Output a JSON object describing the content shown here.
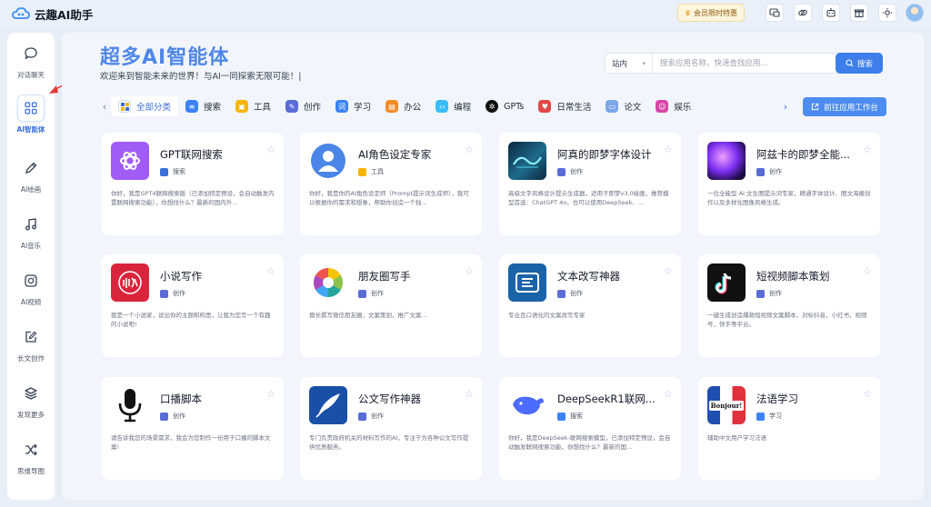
{
  "app": {
    "title": "云趣AI助手"
  },
  "topbar": {
    "vip_label": "会员限时特惠"
  },
  "sidebar": {
    "items": [
      {
        "label": "对话聊天",
        "icon": "chat-icon"
      },
      {
        "label": "AI智能体",
        "icon": "grid-icon",
        "active": true
      },
      {
        "label": "AI绘画",
        "icon": "pen-icon"
      },
      {
        "label": "AI音乐",
        "icon": "music-icon"
      },
      {
        "label": "AI视频",
        "icon": "video-icon"
      },
      {
        "label": "长文创作",
        "icon": "edit-icon"
      },
      {
        "label": "发现更多",
        "icon": "layers-icon"
      },
      {
        "label": "思维导图",
        "icon": "shuffle-icon"
      }
    ]
  },
  "hero": {
    "title": "超多AI智能体",
    "subtitle": "欢迎来到智能未来的世界！与AI一同探索无限可能！|"
  },
  "search": {
    "scope": "站内",
    "placeholder": "搜索应用名称、快速查找应用...",
    "button": "搜索"
  },
  "tabs": [
    {
      "label": "全部分类",
      "active": true,
      "color": "#3b6fd8"
    },
    {
      "label": "搜索",
      "color": "#3b82f6"
    },
    {
      "label": "工具",
      "color": "#f5b400"
    },
    {
      "label": "创作",
      "color": "#5b6bd8"
    },
    {
      "label": "学习",
      "color": "#3b82f6"
    },
    {
      "label": "办公",
      "color": "#f28c28"
    },
    {
      "label": "编程",
      "color": "#38bdf8"
    },
    {
      "label": "GPTs",
      "color": "#111111"
    },
    {
      "label": "日常生活",
      "color": "#e04848"
    },
    {
      "label": "论文",
      "color": "#7da6e8"
    },
    {
      "label": "娱乐",
      "color": "#d946a8"
    }
  ],
  "workbench_button": "前往应用工作台",
  "cards": [
    {
      "title": "GPT联网搜索",
      "tag": "搜索",
      "desc": "你好，我是GPT4联网搜索版（已添加特定预设，会自动触发内置联网搜索功能），你想找什么？最新的国内外...",
      "thumb": "gpt"
    },
    {
      "title": "AI角色设定专家",
      "tag": "工具",
      "desc": "你好，我是你的AI角色设定师（Prompt提示词生成师），我可以根据你的需求和想象，帮助你创造一个独...",
      "thumb": "role"
    },
    {
      "title": "阿真的即梦字体设计",
      "tag": "创作",
      "desc": "高级文字风格设计提示生成器，适用于即梦v3.0绘画，推荐模型首选：ChatGPT 4o，也可以使用DeepSeek、...",
      "thumb": "font"
    },
    {
      "title": "阿兹卡的即梦全能...",
      "tag": "创作",
      "desc": "一位全能型 AI 文生图提示词专家，精通字体设计、图文海报创作以及多样化图像风格生成。",
      "thumb": "azka"
    },
    {
      "title": "小说写作",
      "tag": "创作",
      "desc": "我是一个小说家，说出你的主题和构思，让我为您写一个有趣的小说吧!",
      "thumb": "novel"
    },
    {
      "title": "朋友圈写手",
      "tag": "创作",
      "desc": "擅长撰写微信朋友圈，文案策划，推广文案...",
      "thumb": "moments"
    },
    {
      "title": "文本改写神器",
      "tag": "创作",
      "desc": "专业且口语化的文案改写专家",
      "thumb": "rewrite"
    },
    {
      "title": "短视频脚本策划",
      "tag": "创作",
      "desc": "一键生成创造爆款短视频文案脚本。对标抖音，小红书，视频号，快手等平台。",
      "thumb": "tiktok"
    },
    {
      "title": "口播脚本",
      "tag": "创作",
      "desc": "请告诉我您的场景需求，我会为您制作一份用于口播的脚本文案!",
      "thumb": "mic"
    },
    {
      "title": "公文写作神器",
      "tag": "创作",
      "desc": "专门负责政府机关的材料写作的AI，专注于为各种公文写作提供优质服务。",
      "thumb": "official"
    },
    {
      "title": "DeepSeekR1联网...",
      "tag": "搜索",
      "desc": "你好，我是DeepSeek-联网搜索模型，已添加特定预设，会自动触发联网搜索功能，你想找什么？最新的国...",
      "thumb": "deepseek"
    },
    {
      "title": "法语学习",
      "tag": "学习",
      "desc": "辅助中文用户学习法语",
      "thumb": "french",
      "thumb_text": "Bonjour!"
    }
  ]
}
